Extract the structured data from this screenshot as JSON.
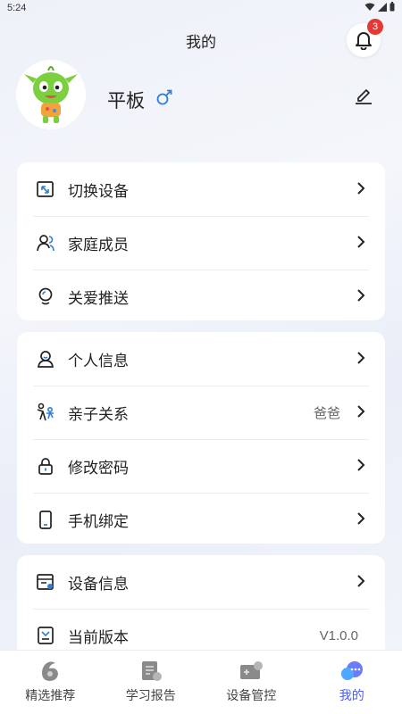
{
  "status": {
    "time": "5:24"
  },
  "header": {
    "title": "我的",
    "notification_count": "3"
  },
  "profile": {
    "name": "平板",
    "gender_symbol": "♂"
  },
  "groups": [
    {
      "items": [
        {
          "label": "切换设备",
          "icon": "switch-device-icon"
        },
        {
          "label": "家庭成员",
          "icon": "family-members-icon"
        },
        {
          "label": "关爱推送",
          "icon": "care-push-icon"
        }
      ]
    },
    {
      "items": [
        {
          "label": "个人信息",
          "icon": "personal-info-icon"
        },
        {
          "label": "亲子关系",
          "icon": "parent-child-icon",
          "value": "爸爸"
        },
        {
          "label": "修改密码",
          "icon": "lock-icon"
        },
        {
          "label": "手机绑定",
          "icon": "phone-icon"
        }
      ]
    },
    {
      "items": [
        {
          "label": "设备信息",
          "icon": "device-info-icon"
        },
        {
          "label": "当前版本",
          "icon": "version-icon",
          "value": "V1.0.0"
        }
      ]
    }
  ],
  "tabs": [
    {
      "label": "精选推荐",
      "icon": "recommend-icon"
    },
    {
      "label": "学习报告",
      "icon": "study-report-icon"
    },
    {
      "label": "设备管控",
      "icon": "device-control-icon"
    },
    {
      "label": "我的",
      "icon": "mine-icon",
      "active": true
    }
  ],
  "colors": {
    "accent": "#4a5bff",
    "badge": "#e53935",
    "gender": "#2f7fd6"
  }
}
